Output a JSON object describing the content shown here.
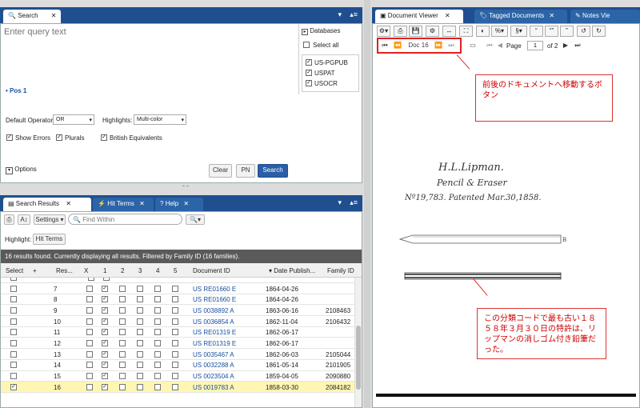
{
  "search": {
    "tab_label": "Search",
    "query_placeholder": "Enter query text",
    "pos_label": "Pos 1",
    "databases_label": "Databases",
    "select_all_label": "Select all",
    "databases": [
      "US-PGPUB",
      "USPAT",
      "USOCR"
    ],
    "default_operator_label": "Default Operator:",
    "default_operator_value": "OR",
    "highlights_label": "Highlights:",
    "highlights_value": "Multi-color",
    "show_errors_label": "Show Errors",
    "plurals_label": "Plurals",
    "british_label": "British Equivalents",
    "options_label": "Options",
    "clear_label": "Clear",
    "pn_label": "PN",
    "search_label": "Search"
  },
  "results": {
    "tabs": [
      "Search Results",
      "Hit Terms",
      "Help"
    ],
    "settings_label": "Settings",
    "find_placeholder": "Find Within",
    "highlight_label": "Highlight:",
    "hit_terms_button": "Hit Terms",
    "status_text": "16 results found. Currently displaying all results. Filtered by Family ID (16 families).",
    "columns": [
      "Select",
      "+",
      "Res...",
      "X",
      "1",
      "2",
      "3",
      "4",
      "5",
      "Document ID",
      "Date Publish...",
      "Family ID"
    ],
    "rows": [
      {
        "res": "7",
        "check1": true,
        "doc": "US RE01660 E",
        "date": "1864-04-26",
        "family": "",
        "selected": false
      },
      {
        "res": "8",
        "check1": true,
        "doc": "US RE01660 E",
        "date": "1864-04-26",
        "family": "",
        "selected": false
      },
      {
        "res": "9",
        "check1": true,
        "doc": "US 0038892 A",
        "date": "1863-06-16",
        "family": "2108463",
        "selected": false
      },
      {
        "res": "10",
        "check1": true,
        "doc": "US 0036854 A",
        "date": "1862-11-04",
        "family": "2106432",
        "selected": false
      },
      {
        "res": "11",
        "check1": true,
        "doc": "US RE01319 E",
        "date": "1862-06-17",
        "family": "",
        "selected": false
      },
      {
        "res": "12",
        "check1": true,
        "doc": "US RE01319 E",
        "date": "1862-06-17",
        "family": "",
        "selected": false
      },
      {
        "res": "13",
        "check1": true,
        "doc": "US 0035467 A",
        "date": "1862-06-03",
        "family": "2105044",
        "selected": false
      },
      {
        "res": "14",
        "check1": true,
        "doc": "US 0032288 A",
        "date": "1861-05-14",
        "family": "2101905",
        "selected": false
      },
      {
        "res": "15",
        "check1": true,
        "doc": "US 0023504 A",
        "date": "1859-04-05",
        "family": "2090880",
        "selected": false
      },
      {
        "res": "16",
        "check1": true,
        "doc": "US 0019783 A",
        "date": "1858-03-30",
        "family": "2084182",
        "selected": true
      }
    ]
  },
  "viewer": {
    "tabs": [
      "Document Viewer",
      "Tagged Documents",
      "Notes Vie"
    ],
    "doc_label": "Doc 16",
    "page_label": "Page",
    "page_value": "1",
    "page_of": "of 2",
    "callout_nav": "前後のドキュメントへ移動するボタン",
    "callout_patent": "この分類コードで最も古い１８５８年３月３０日の特許は、リップマンの消しゴム付き鉛筆だった。",
    "drawing_title": "H.L.Lipman.",
    "drawing_subtitle": "Pencil & Eraser",
    "drawing_number": "Nº19,783. Patented Mar.30,1858."
  },
  "colors": {
    "tabbar": "#1f4f8f",
    "link": "#1a4fa0",
    "selected_row": "#fff6b3",
    "callout_border": "#dd3333"
  }
}
